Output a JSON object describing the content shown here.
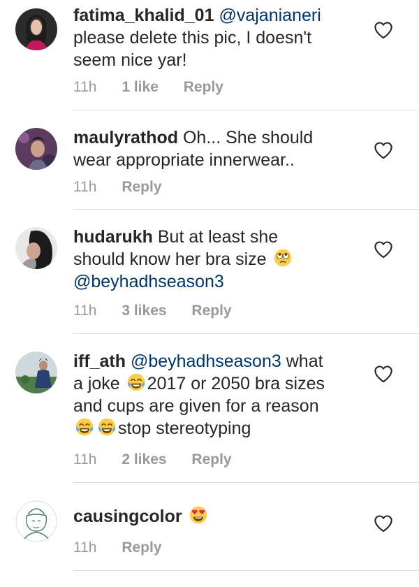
{
  "comments": [
    {
      "username": "fatima_khalid_01",
      "mention": "@vajanianeri",
      "text_lines": [
        "please delete this pic, I doesn't",
        "seem nice yar!"
      ],
      "time": "11h",
      "likes": "1 like",
      "reply": "Reply"
    },
    {
      "username": "maulyrathod",
      "line1_text": "Oh... She should",
      "line2_text": "wear appropriate innerwear..",
      "time": "11h",
      "reply": "Reply"
    },
    {
      "username": "hudarukh",
      "line1_text": "But at least she",
      "line2_text": "should know her bra size",
      "emoji": "face-with-rolling-eyes",
      "mention": "@beyhadhseason3",
      "time": "11h",
      "likes": "3 likes",
      "reply": "Reply"
    },
    {
      "username": "iff_ath",
      "mention": "@beyhadhseason3",
      "line1_text": "what",
      "line2_a": "a joke",
      "line2_b": "2017 or 2050 bra sizes",
      "line3_text": "and cups are given for a reason",
      "line4_text": "stop stereotyping",
      "emoji": "face-with-tears-of-joy",
      "time": "11h",
      "likes": "2 likes",
      "reply": "Reply"
    },
    {
      "username": "causingcolor",
      "emoji": "smiling-face-with-heart-eyes",
      "time": "11h",
      "reply": "Reply"
    }
  ],
  "colors": {
    "text": "#262626",
    "mention": "#003569",
    "meta": "#999999",
    "divider": "#dbdbdb",
    "emoji_yellow": "#FFCC4D"
  },
  "icons": [
    "heart-outline-icon",
    "avatar"
  ]
}
